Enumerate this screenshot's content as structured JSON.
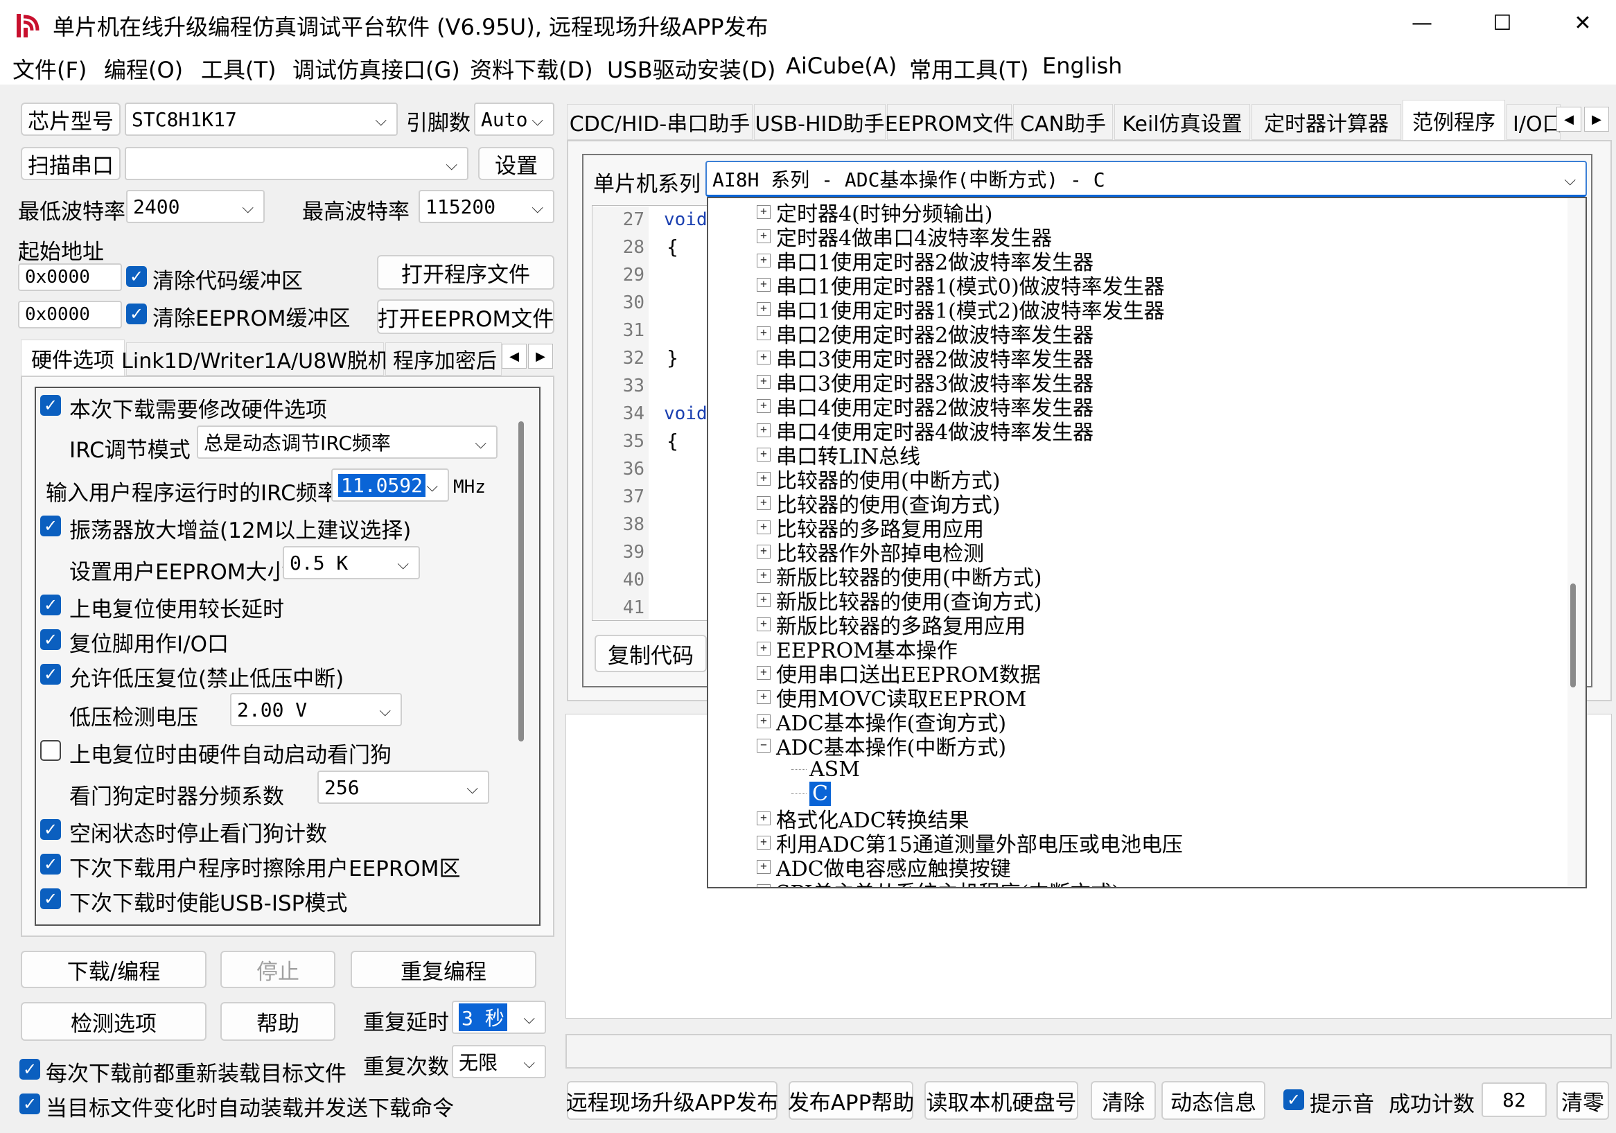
{
  "window": {
    "title": "单片机在线升级编程仿真调试平台软件 (V6.95U), 远程现场升级APP发布",
    "minimize": "—",
    "maximize": "☐",
    "close": "✕"
  },
  "menu": [
    "文件(F)",
    "编程(O)",
    "工具(T)",
    "调试仿真接口(G)",
    "资料下载(D)",
    "USB驱动安装(D)",
    "AiCube(A)",
    "常用工具(T)",
    "English"
  ],
  "left": {
    "chip_btn": "芯片型号",
    "chip_value": "STC8H1K17",
    "pins_label": "引脚数",
    "pins_value": "Auto",
    "scan_btn": "扫描串口",
    "port_value": "",
    "settings_btn": "设置",
    "min_baud_label": "最低波特率",
    "min_baud": "2400",
    "max_baud_label": "最高波特率",
    "max_baud": "115200",
    "start_addr_label": "起始地址",
    "addr1": "0x0000",
    "clear_code": "清除代码缓冲区",
    "open_prog": "打开程序文件",
    "addr2": "0x0000",
    "clear_eeprom": "清除EEPROM缓冲区",
    "open_eeprom": "打开EEPROM文件",
    "tabs": [
      "硬件选项",
      "Link1D/Writer1A/U8W脱机",
      "程序加密后"
    ],
    "hw": {
      "opt1": "本次下载需要修改硬件选项",
      "irc_mode_label": "IRC调节模式",
      "irc_mode": "总是动态调节IRC频率",
      "irc_freq_label": "输入用户程序运行时的IRC频率",
      "irc_freq": "11.0592",
      "irc_unit": "MHz",
      "opt2": "振荡器放大增益(12M以上建议选择)",
      "eeprom_size_label": "设置用户EEPROM大小",
      "eeprom_size": "0.5 K",
      "opt3": "上电复位使用较长延时",
      "opt4": "复位脚用作I/O口",
      "opt5": "允许低压复位(禁止低压中断)",
      "lv_label": "低压检测电压",
      "lv_value": "2.00 V",
      "opt6": "上电复位时由硬件自动启动看门狗",
      "wdt_label": "看门狗定时器分频系数",
      "wdt_value": "256",
      "opt7": "空闲状态时停止看门狗计数",
      "opt8": "下次下载用户程序时擦除用户EEPROM区",
      "opt9": "下次下载时使能USB-ISP模式"
    },
    "download_btn": "下载/编程",
    "stop_btn": "停止",
    "reprog_btn": "重复编程",
    "check_btn": "检测选项",
    "help_btn": "帮助",
    "delay_label": "重复延时",
    "delay_value": "3 秒",
    "count_label": "重复次数",
    "count_value": "无限",
    "reload": "每次下载前都重新装载目标文件",
    "autoload": "当目标文件变化时自动装载并发送下载命令"
  },
  "right": {
    "tabs": [
      "CDC/HID-串口助手",
      "USB-HID助手",
      "EEPROM文件",
      "CAN助手",
      "Keil仿真设置",
      "定时器计算器",
      "范例程序",
      "I/O口"
    ],
    "series_label": "单片机系列",
    "series_value": "AI8H 系列 - ADC基本操作(中断方式) - C",
    "line_numbers": [
      "27",
      "28",
      "29",
      "30",
      "31",
      "32",
      "33",
      "34",
      "35",
      "36",
      "37",
      "38",
      "39",
      "40",
      "41"
    ],
    "code": {
      "l27": "void",
      "l28": "{",
      "l32": "}",
      "l34": "void",
      "l35": "{"
    },
    "copy_btn": "复制代码",
    "tree": [
      "定时器4(时钟分频输出)",
      "定时器4做串口4波特率发生器",
      "串口1使用定时器2做波特率发生器",
      "串口1使用定时器1(模式0)做波特率发生器",
      "串口1使用定时器1(模式2)做波特率发生器",
      "串口2使用定时器2做波特率发生器",
      "串口3使用定时器2做波特率发生器",
      "串口3使用定时器3做波特率发生器",
      "串口4使用定时器2做波特率发生器",
      "串口4使用定时器4做波特率发生器",
      "串口转LIN总线",
      "比较器的使用(中断方式)",
      "比较器的使用(查询方式)",
      "比较器的多路复用应用",
      "比较器作外部掉电检测",
      "新版比较器的使用(中断方式)",
      "新版比较器的使用(查询方式)",
      "新版比较器的多路复用应用",
      "EEPROM基本操作",
      "使用串口送出EEPROM数据",
      "使用MOVC读取EEPROM",
      "ADC基本操作(查询方式)",
      "ADC基本操作(中断方式)"
    ],
    "tree_children": [
      "ASM",
      "C"
    ],
    "tree_after": [
      "格式化ADC转换结果",
      "利用ADC第15通道测量外部电压或电池电压",
      "ADC做电容感应触摸按键",
      "SPI单主单从系统主机程序(中断方式)"
    ],
    "bottom": {
      "remote_btn": "远程现场升级APP发布",
      "apphelp_btn": "发布APP帮助",
      "readdisk_btn": "读取本机硬盘号",
      "clear_btn": "清除",
      "dyn_btn": "动态信息",
      "sound": "提示音",
      "success_label": "成功计数",
      "success_count": "82",
      "reset_btn": "清零"
    }
  }
}
